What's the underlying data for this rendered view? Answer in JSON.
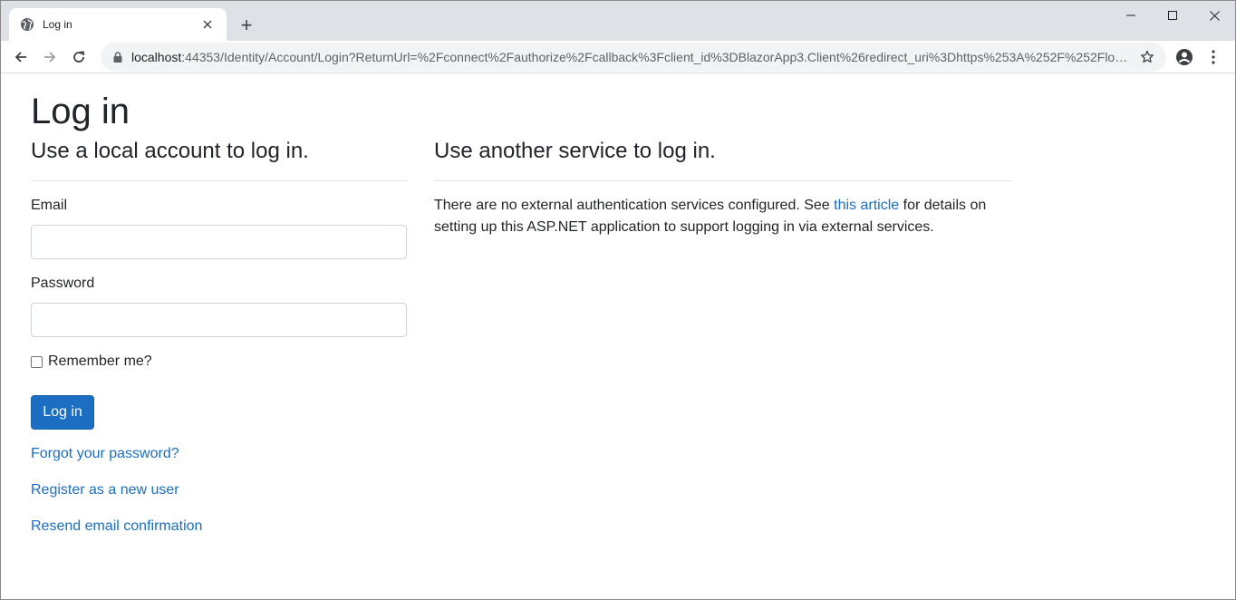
{
  "browser": {
    "tab_title": "Log in",
    "new_tab_label": "+",
    "url_host": "localhost",
    "url_rest": ":44353/Identity/Account/Login?ReturnUrl=%2Fconnect%2Fauthorize%2Fcallback%3Fclient_id%3DBlazorApp3.Client%26redirect_uri%3Dhttps%253A%252F%252Flocalho..."
  },
  "page": {
    "title": "Log in",
    "local": {
      "heading": "Use a local account to log in.",
      "email_label": "Email",
      "email_value": "",
      "password_label": "Password",
      "password_value": "",
      "remember_label": "Remember me?",
      "remember_checked": false,
      "submit_label": "Log in",
      "links": {
        "forgot": "Forgot your password?",
        "register": "Register as a new user",
        "resend": "Resend email confirmation"
      }
    },
    "external": {
      "heading": "Use another service to log in.",
      "text_before": "There are no external authentication services configured. See ",
      "link_text": "this article",
      "text_after": " for details on setting up this ASP.NET application to support logging in via external services."
    }
  },
  "colors": {
    "primary": "#1b6ec2",
    "tabstrip": "#dee1e6",
    "omnibox": "#f1f3f4"
  }
}
